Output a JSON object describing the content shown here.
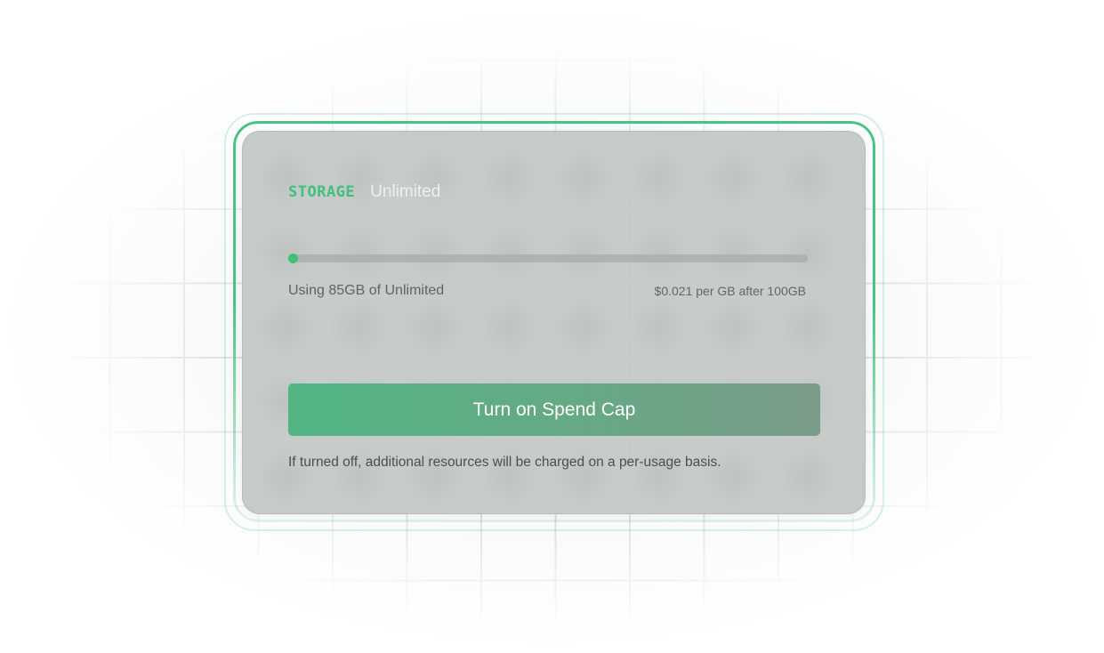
{
  "storage_card": {
    "section_label": "STORAGE",
    "plan_name": "Unlimited",
    "usage_text": "Using 85GB of Unlimited",
    "price_text": "$0.021 per GB after 100GB",
    "progress_fraction": 0.0,
    "spend_cap_button_label": "Turn on Spend Cap",
    "note_text": "If turned off, additional resources will be charged on a per-usage basis."
  },
  "colors": {
    "accent": "#3fc07c",
    "card_background": "#c5c9c7",
    "button_gradient_start": "#52b684",
    "button_gradient_end": "#7b9c88"
  }
}
